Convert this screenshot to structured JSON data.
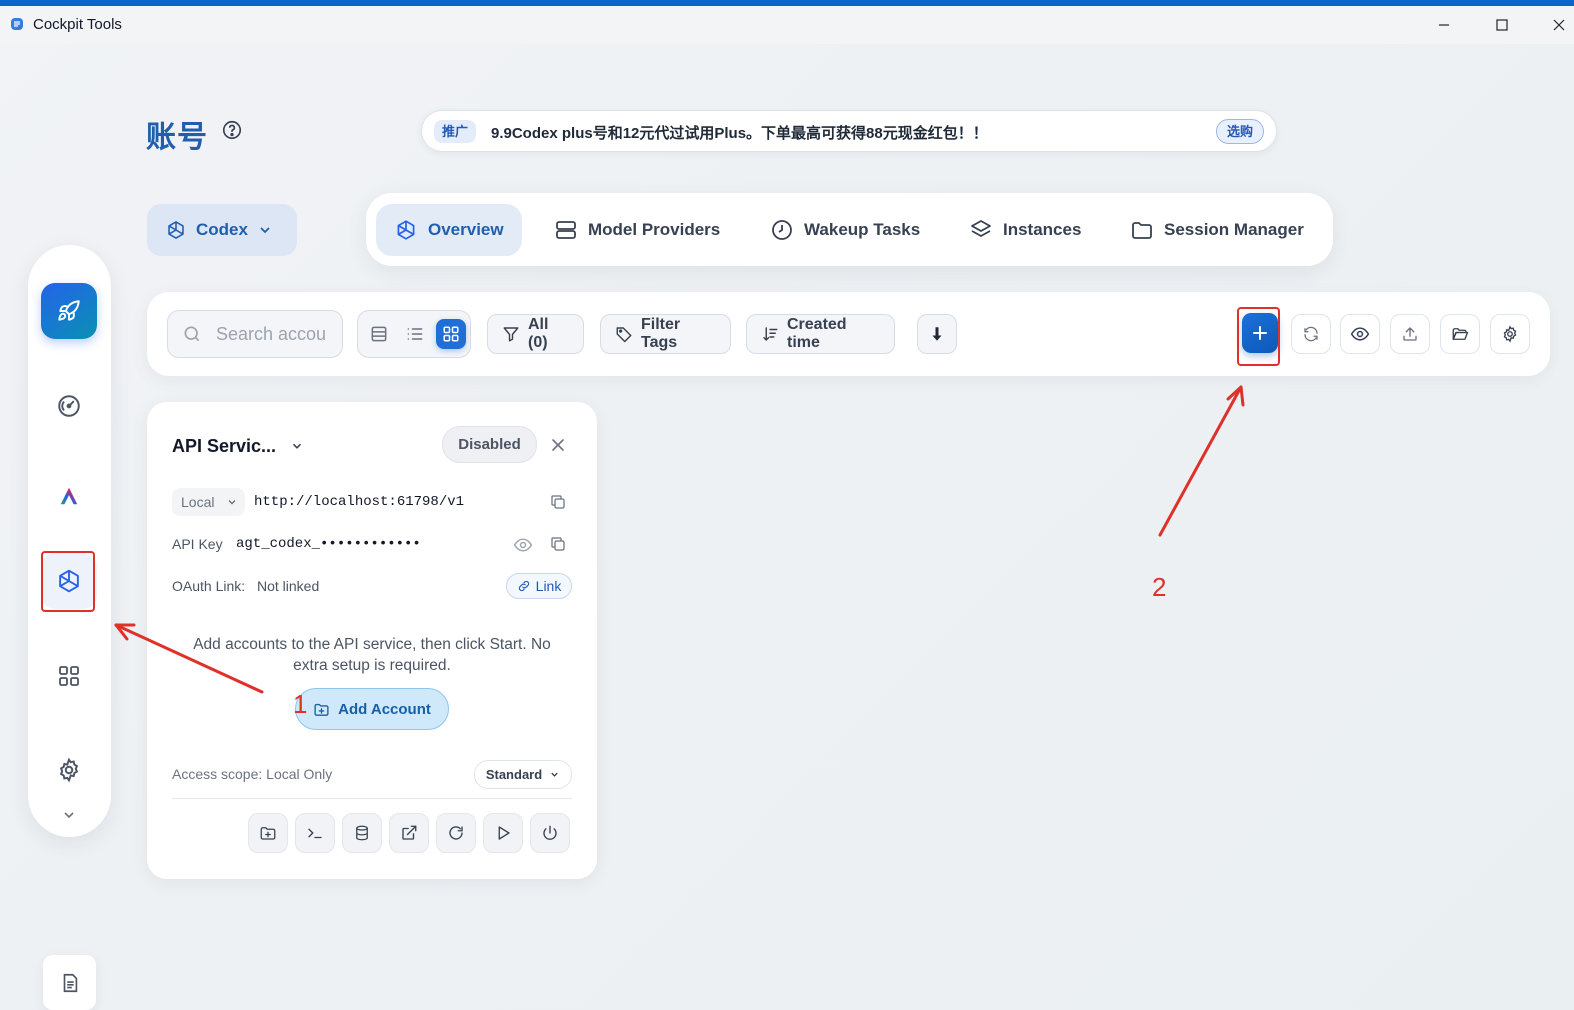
{
  "window": {
    "title": "Cockpit Tools"
  },
  "header": {
    "title": "账号",
    "promo": {
      "tag": "推广",
      "text": "9.9Codex plus号和12元代过试用Plus。下单最高可获得88元现金红包！！",
      "button": "选购"
    }
  },
  "product_switcher": {
    "label": "Codex"
  },
  "tabs": [
    {
      "label": "Overview",
      "icon": "openai-icon",
      "active": true
    },
    {
      "label": "Model Providers",
      "icon": "server-icon"
    },
    {
      "label": "Wakeup Tasks",
      "icon": "clock-icon"
    },
    {
      "label": "Instances",
      "icon": "layers-icon"
    },
    {
      "label": "Session Manager",
      "icon": "folder-icon"
    }
  ],
  "toolbar": {
    "search_placeholder": "Search accou",
    "filter_label": "All (0)",
    "tags_label": "Filter Tags",
    "sort_label": "Created time"
  },
  "card": {
    "title": "API Servic...",
    "status": "Disabled",
    "endpoint_mode": "Local",
    "url": "http://localhost:61798/v1",
    "api_key_label": "API Key",
    "api_key_value": "agt_codex_••••••••••••",
    "oauth_label": "OAuth Link:",
    "oauth_value": "Not linked",
    "link_button": "Link",
    "empty_message": "Add accounts to the API service, then click Start. No extra setup is required.",
    "add_account_button": "Add Account",
    "scope_label": "Access scope: Local Only",
    "scope_select": "Standard"
  },
  "annotations": {
    "marker_1": "1",
    "marker_2": "2"
  },
  "colors": {
    "accent": "#1f5fae",
    "primary_button": "#1d70d9",
    "annotation": "#e0302a"
  }
}
